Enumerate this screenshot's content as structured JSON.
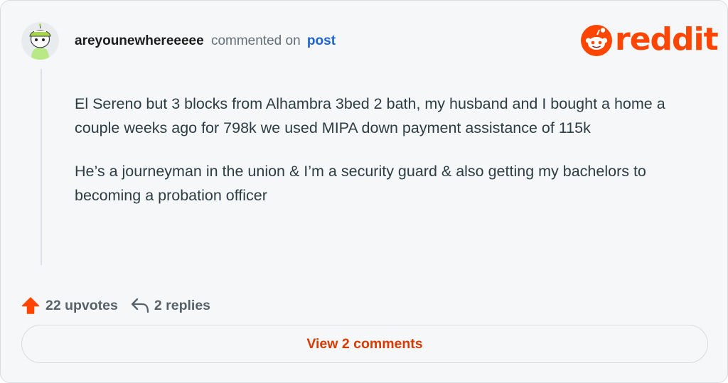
{
  "comment": {
    "username": "areyounewhereeeee",
    "action_text": "commented on",
    "post_link": "post",
    "paragraphs": [
      "El Sereno but 3 blocks from Alhambra 3bed 2 bath, my husband and I bought a home a couple weeks ago for 798k we used MIPA down payment assistance of 115k",
      "He’s a journeyman in the union & I’m a security guard & also getting my bachelors to becoming a probation officer"
    ]
  },
  "brand": {
    "name": "reddit",
    "color": "#ff4500"
  },
  "stats": {
    "upvotes": "22 upvotes",
    "replies": "2 replies",
    "upvote_icon": "arrow-up-icon",
    "reply_icon": "reply-arrow-icon",
    "upvote_color": "#ff4500"
  },
  "cta": {
    "label": "View 2 comments",
    "color": "#d93a00"
  }
}
